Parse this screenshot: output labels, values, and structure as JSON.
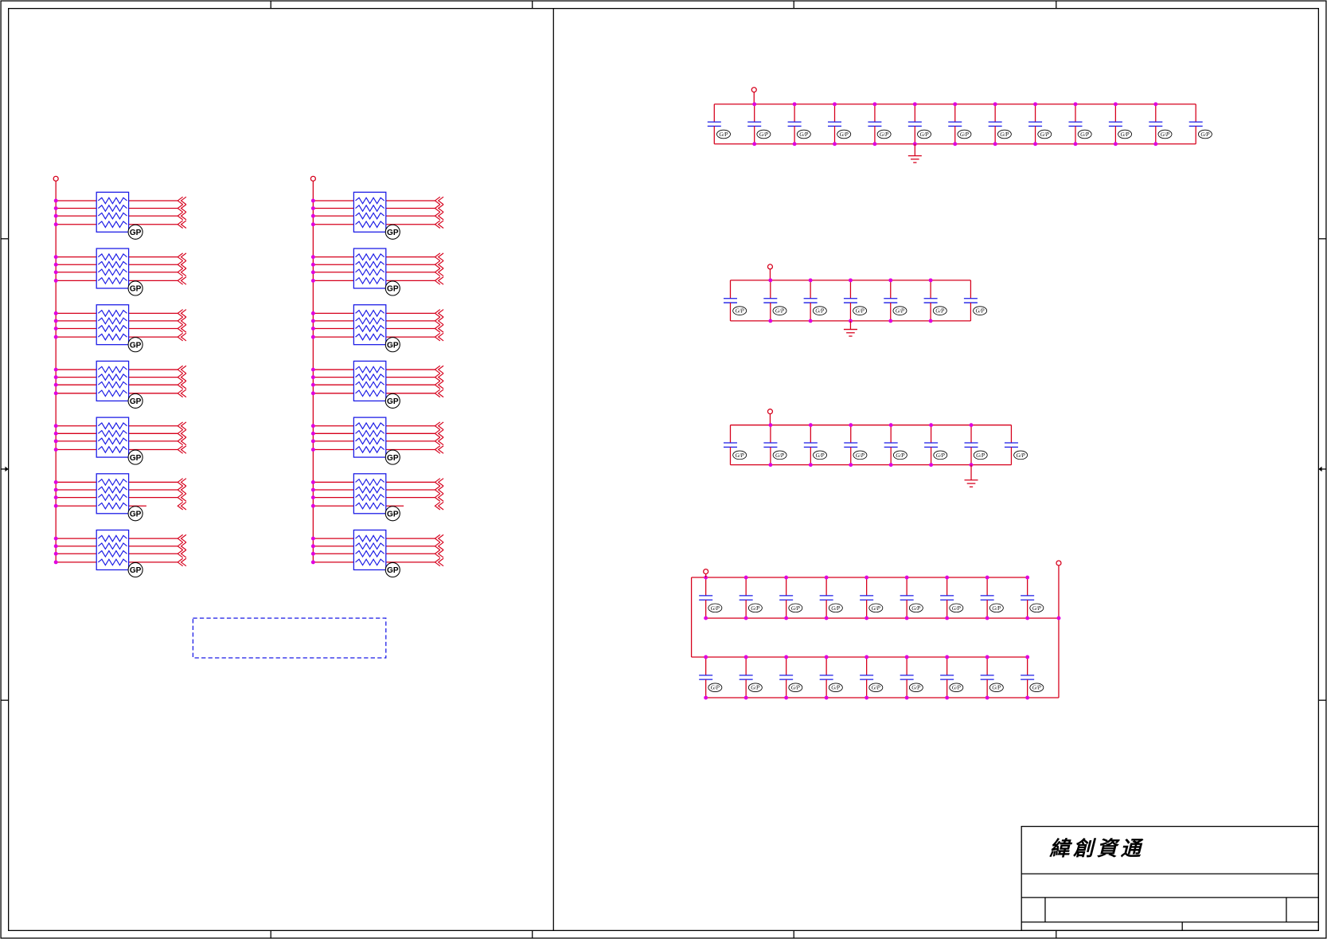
{
  "title_block": {
    "company_name": "緯創資通"
  },
  "labels": {
    "resistor_pack_tag": "GP",
    "capacitor_tag": "G/P"
  },
  "colors": {
    "wire": "#d6001c",
    "junction": "#e000e0",
    "component": "#1a1ae6",
    "frame": "#000000",
    "text": "#000000"
  }
}
